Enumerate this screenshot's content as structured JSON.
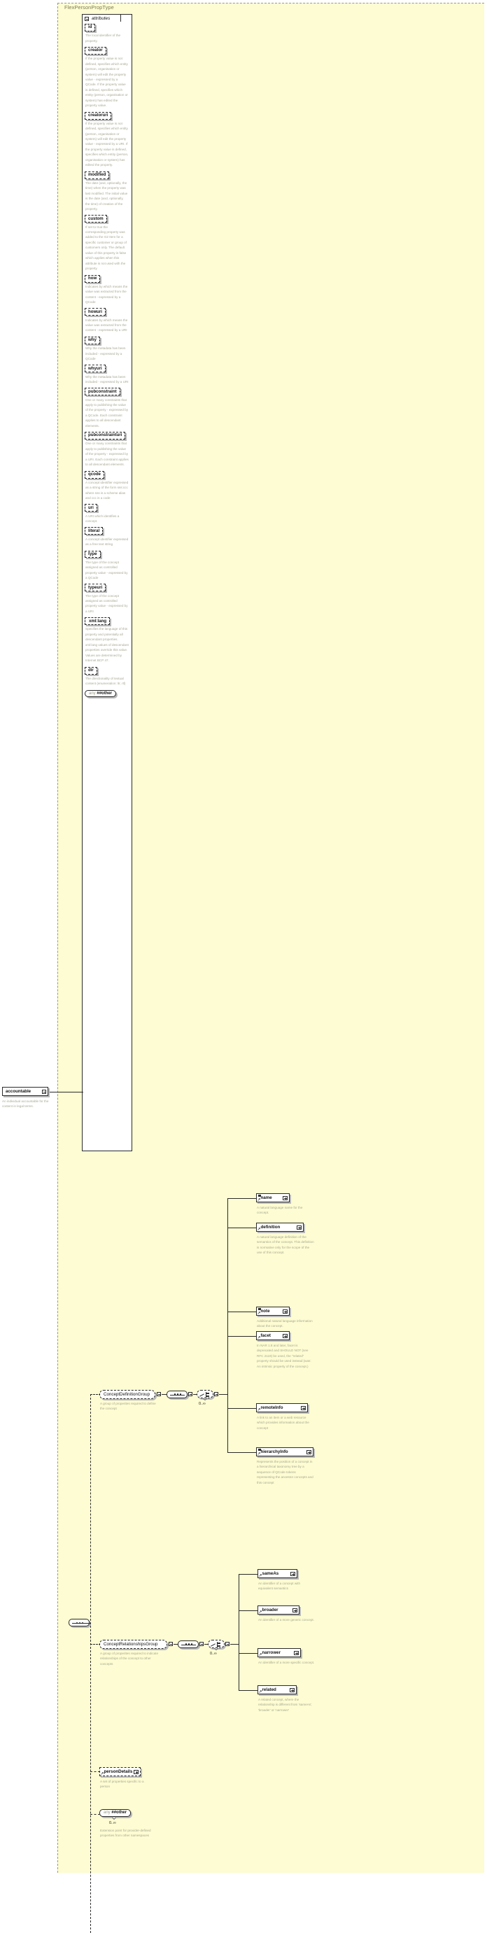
{
  "diagram": {
    "root_type": "FlexPersonPropType",
    "attributes_panel_label": "attributes"
  },
  "attributes": [
    {
      "name": "id",
      "doc": "The local identifier of the property."
    },
    {
      "name": "creator",
      "doc": "If the property value is not defined, specifies which entity (person, organisation or system) will edit the property value - expressed by a QCode. If the property value is defined, specifies which entity (person, organisation or system) has edited the property value."
    },
    {
      "name": "creatoruri",
      "doc": "If the property value is not defined, specifies which entity (person, organisation or system) will edit the property value - expressed by a URI. If the property value is defined, specifies which entity (person, organisation or system) has edited the property."
    },
    {
      "name": "modified",
      "doc": "The date (and, optionally, the time) when the property was last modified. The initial value is the date (and, optionally, the time) of creation of the property."
    },
    {
      "name": "custom",
      "doc": "If set to true the corresponding property was added to the G2 Item for a specific customer or group of customers only. The default value of this property is false which applies when this attribute is not used with the property"
    },
    {
      "name": "how",
      "doc": "Indicates by which means the value was extracted from the content - expressed by a QCode"
    },
    {
      "name": "howuri",
      "doc": "Indicates by which means the value was extracted from the content - expressed by a URI"
    },
    {
      "name": "why",
      "doc": "Why the metadata has been included - expressed by a QCode"
    },
    {
      "name": "whyuri",
      "doc": "Why the metadata has been included - expressed by a URI"
    },
    {
      "name": "pubconstraint",
      "doc": "One or many constraints that apply to publishing the value of the property - expressed by a QCode. Each constraint applies to all descendant elements."
    },
    {
      "name": "pubconstrainturi",
      "doc": "One or many constraints that apply to publishing the value of the property - expressed by a URI. Each constraint applies to all descendant elements."
    },
    {
      "name": "qcode",
      "doc": "A concept identifier expressed as a string of the form sss:ccc where sss is a scheme alias and ccc is a code"
    },
    {
      "name": "uri",
      "doc": "A URI which identifies a concept."
    },
    {
      "name": "literal",
      "doc": "A concept identifier expressed as a free text string"
    },
    {
      "name": "type",
      "doc": "The type of the concept assigned as controlled property value - expressed by a QCode"
    },
    {
      "name": "typeuri",
      "doc": "The type of the concept assigned as controlled property value - expressed by a URI"
    },
    {
      "name": "xml:lang",
      "doc": "Specifies the language of this property and potentially all descendant properties. xml:lang values of descendant properties override this value. Values are determined by Internet BCP 47."
    },
    {
      "name": "dir",
      "doc": "The directionality of textual content (enumeration: ltr, rtl)"
    }
  ],
  "attributes_any": {
    "keyword": "any",
    "namespace": "##other"
  },
  "accountable": {
    "label": "accountable",
    "doc": "An individual accountable for the content in legal terms."
  },
  "concept_definition_group": {
    "label": "ConceptDefinitionGroup",
    "doc": "A group of properites required to define the concept",
    "cardinality": "0..∞",
    "children": [
      {
        "name": "name",
        "doc": "A natural language name for the concept."
      },
      {
        "name": "definition",
        "doc": "A natural language definition of the semantics of the concept. This definition is normative only for the scope of the use of this concept."
      },
      {
        "name": "note",
        "doc": "Additional natural language information about the concept."
      },
      {
        "name": "facet",
        "doc": "In NAR 1.8 and later, facet is deprecated and SHOULD NOT (see RFC 2119) be used, the \"related\" property should be used instead (was: An intrinsic property of the concept.)"
      },
      {
        "name": "remoteInfo",
        "doc": "A link to an item or a web resource which provides information about the concept"
      },
      {
        "name": "hierarchyInfo",
        "doc": "Represents the position of a concept in a hierarchical taxonomy tree by a sequence of QCode tokens representing the ancestor concepts and this concept"
      }
    ]
  },
  "concept_relationships_group": {
    "label": "ConceptRelationshipsGroup",
    "doc": "A group of properites required to indicate relationships of the concept to other concepts",
    "cardinality": "0..∞",
    "children": [
      {
        "name": "sameAs",
        "doc": "An identifier of a concept with equivalent semantics"
      },
      {
        "name": "broader",
        "doc": "An identifier of a more generic concept."
      },
      {
        "name": "narrower",
        "doc": "An identifier of a more specific concept."
      },
      {
        "name": "related",
        "doc": "A related concept, where the relationship is different from 'sameAs', 'broader' or 'narrower'"
      }
    ]
  },
  "person_details": {
    "label": "personDetails",
    "doc": "A set of properties specific to a person"
  },
  "content_any": {
    "keyword": "any",
    "namespace": "##other",
    "cardinality": "0..∞",
    "doc": "Extension point for provider-defined properties from other namespaces"
  },
  "colors": {
    "canvas": "#fdfcd2",
    "box_border": "#2b2b2b",
    "doc_text": "#a8a893",
    "title_text": "#7a7a55"
  }
}
